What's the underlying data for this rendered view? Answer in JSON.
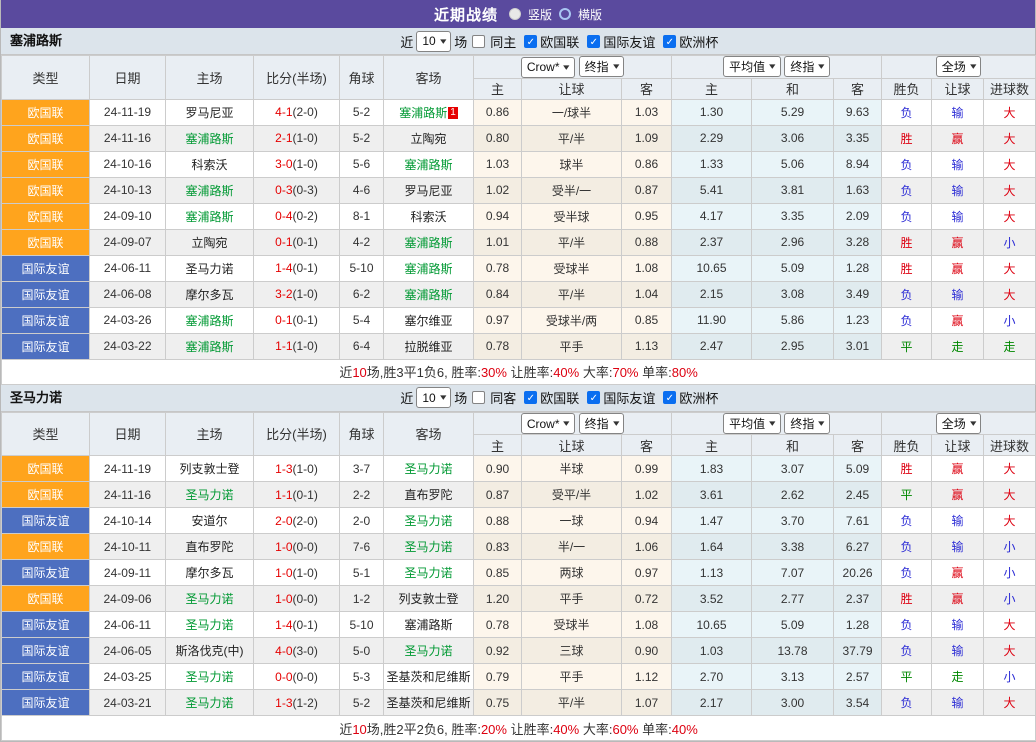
{
  "title_bar": {
    "title": "近期战绩",
    "radio_options": [
      {
        "label": "竖版",
        "selected": true
      },
      {
        "label": "横版",
        "selected": false
      }
    ]
  },
  "columns": {
    "type": "类型",
    "date": "日期",
    "home": "主场",
    "score": "比分(半场)",
    "corner": "角球",
    "away": "客场",
    "sub": [
      "主",
      "让球",
      "客",
      "主",
      "和",
      "客",
      "胜负",
      "让球",
      "进球数"
    ]
  },
  "league_colors": {
    "欧国联": "orange",
    "国际友谊": "blue"
  },
  "result_colors": {
    "胜": "red",
    "平": "green",
    "负": "blue",
    "赢": "red",
    "输": "blue",
    "走": "green",
    "大": "red",
    "小": "blue"
  },
  "colors": {
    "purple_bar": "#5a4a9e",
    "league_orange": "#ffa41d",
    "league_blue": "#4d6fc0",
    "team_highlight_green": "#009933",
    "score_red": "#e50000",
    "result_red": "#dd0010",
    "result_blue": "#2b2bd5",
    "result_green": "#008800"
  },
  "sections": [
    {
      "team": "塞浦路斯",
      "filters": {
        "near": "近",
        "count": "10",
        "games": "场",
        "same": "同主",
        "leagues": [
          "欧国联",
          "国际友谊",
          "欧洲杯"
        ]
      },
      "dropdowns": [
        "Crow*",
        "终指",
        "平均值",
        "终指",
        "全场"
      ],
      "rows": [
        {
          "lg": "欧国联",
          "dt": "24-11-19",
          "hm": "罗马尼亚",
          "hmG": false,
          "sc": "4-1",
          "hf": "(2-0)",
          "cn": "5-2",
          "aw": "塞浦路斯",
          "awG": true,
          "bd": "1",
          "od": [
            "0.86",
            "一/球半",
            "1.03"
          ],
          "av": [
            "1.30",
            "5.29",
            "9.63"
          ],
          "rs": [
            "负",
            "输",
            "大"
          ]
        },
        {
          "lg": "欧国联",
          "dt": "24-11-16",
          "hm": "塞浦路斯",
          "hmG": true,
          "sc": "2-1",
          "hf": "(1-0)",
          "cn": "5-2",
          "aw": "立陶宛",
          "awG": false,
          "od": [
            "0.80",
            "平/半",
            "1.09"
          ],
          "av": [
            "2.29",
            "3.06",
            "3.35"
          ],
          "rs": [
            "胜",
            "赢",
            "大"
          ]
        },
        {
          "lg": "欧国联",
          "dt": "24-10-16",
          "hm": "科索沃",
          "hmG": false,
          "sc": "3-0",
          "hf": "(1-0)",
          "cn": "5-6",
          "aw": "塞浦路斯",
          "awG": true,
          "od": [
            "1.03",
            "球半",
            "0.86"
          ],
          "av": [
            "1.33",
            "5.06",
            "8.94"
          ],
          "rs": [
            "负",
            "输",
            "大"
          ]
        },
        {
          "lg": "欧国联",
          "dt": "24-10-13",
          "hm": "塞浦路斯",
          "hmG": true,
          "sc": "0-3",
          "hf": "(0-3)",
          "cn": "4-6",
          "aw": "罗马尼亚",
          "awG": false,
          "od": [
            "1.02",
            "受半/一",
            "0.87"
          ],
          "av": [
            "5.41",
            "3.81",
            "1.63"
          ],
          "rs": [
            "负",
            "输",
            "大"
          ]
        },
        {
          "lg": "欧国联",
          "dt": "24-09-10",
          "hm": "塞浦路斯",
          "hmG": true,
          "sc": "0-4",
          "hf": "(0-2)",
          "cn": "8-1",
          "aw": "科索沃",
          "awG": false,
          "od": [
            "0.94",
            "受半球",
            "0.95"
          ],
          "av": [
            "4.17",
            "3.35",
            "2.09"
          ],
          "rs": [
            "负",
            "输",
            "大"
          ]
        },
        {
          "lg": "欧国联",
          "dt": "24-09-07",
          "hm": "立陶宛",
          "hmG": false,
          "sc": "0-1",
          "hf": "(0-1)",
          "cn": "4-2",
          "aw": "塞浦路斯",
          "awG": true,
          "od": [
            "1.01",
            "平/半",
            "0.88"
          ],
          "av": [
            "2.37",
            "2.96",
            "3.28"
          ],
          "rs": [
            "胜",
            "赢",
            "小"
          ]
        },
        {
          "lg": "国际友谊",
          "dt": "24-06-11",
          "hm": "圣马力诺",
          "hmG": false,
          "sc": "1-4",
          "hf": "(0-1)",
          "cn": "5-10",
          "aw": "塞浦路斯",
          "awG": true,
          "od": [
            "0.78",
            "受球半",
            "1.08"
          ],
          "av": [
            "10.65",
            "5.09",
            "1.28"
          ],
          "rs": [
            "胜",
            "赢",
            "大"
          ]
        },
        {
          "lg": "国际友谊",
          "dt": "24-06-08",
          "hm": "摩尔多瓦",
          "hmG": false,
          "sc": "3-2",
          "hf": "(1-0)",
          "cn": "6-2",
          "aw": "塞浦路斯",
          "awG": true,
          "od": [
            "0.84",
            "平/半",
            "1.04"
          ],
          "av": [
            "2.15",
            "3.08",
            "3.49"
          ],
          "rs": [
            "负",
            "输",
            "大"
          ]
        },
        {
          "lg": "国际友谊",
          "dt": "24-03-26",
          "hm": "塞浦路斯",
          "hmG": true,
          "sc": "0-1",
          "hf": "(0-1)",
          "cn": "5-4",
          "aw": "塞尔维亚",
          "awG": false,
          "od": [
            "0.97",
            "受球半/两",
            "0.85"
          ],
          "av": [
            "11.90",
            "5.86",
            "1.23"
          ],
          "rs": [
            "负",
            "赢",
            "小"
          ]
        },
        {
          "lg": "国际友谊",
          "dt": "24-03-22",
          "hm": "塞浦路斯",
          "hmG": true,
          "sc": "1-1",
          "hf": "(1-0)",
          "cn": "6-4",
          "aw": "拉脱维亚",
          "awG": false,
          "od": [
            "0.78",
            "平手",
            "1.13"
          ],
          "av": [
            "2.47",
            "2.95",
            "3.01"
          ],
          "rs": [
            "平",
            "走",
            "走"
          ]
        }
      ],
      "summary": [
        {
          "t": "近",
          "c": "dark"
        },
        {
          "t": "10",
          "c": "red"
        },
        {
          "t": "场,胜3平1负6, 胜率:",
          "c": "dark"
        },
        {
          "t": "30%",
          "c": "red"
        },
        {
          "t": " 让胜率:",
          "c": "dark"
        },
        {
          "t": "40%",
          "c": "red"
        },
        {
          "t": " 大率:",
          "c": "dark"
        },
        {
          "t": "70%",
          "c": "red"
        },
        {
          "t": " 单率:",
          "c": "dark"
        },
        {
          "t": "80%",
          "c": "red"
        }
      ]
    },
    {
      "team": "圣马力诺",
      "filters": {
        "near": "近",
        "count": "10",
        "games": "场",
        "same": "同客",
        "leagues": [
          "欧国联",
          "国际友谊",
          "欧洲杯"
        ]
      },
      "dropdowns": [
        "Crow*",
        "终指",
        "平均值",
        "终指",
        "全场"
      ],
      "rows": [
        {
          "lg": "欧国联",
          "dt": "24-11-19",
          "hm": "列支敦士登",
          "hmG": false,
          "sc": "1-3",
          "hf": "(1-0)",
          "cn": "3-7",
          "aw": "圣马力诺",
          "awG": true,
          "od": [
            "0.90",
            "半球",
            "0.99"
          ],
          "av": [
            "1.83",
            "3.07",
            "5.09"
          ],
          "rs": [
            "胜",
            "赢",
            "大"
          ]
        },
        {
          "lg": "欧国联",
          "dt": "24-11-16",
          "hm": "圣马力诺",
          "hmG": true,
          "sc": "1-1",
          "hf": "(0-1)",
          "cn": "2-2",
          "aw": "直布罗陀",
          "awG": false,
          "od": [
            "0.87",
            "受平/半",
            "1.02"
          ],
          "av": [
            "3.61",
            "2.62",
            "2.45"
          ],
          "rs": [
            "平",
            "赢",
            "大"
          ]
        },
        {
          "lg": "国际友谊",
          "dt": "24-10-14",
          "hm": "安道尔",
          "hmG": false,
          "sc": "2-0",
          "hf": "(2-0)",
          "cn": "2-0",
          "aw": "圣马力诺",
          "awG": true,
          "od": [
            "0.88",
            "一球",
            "0.94"
          ],
          "av": [
            "1.47",
            "3.70",
            "7.61"
          ],
          "rs": [
            "负",
            "输",
            "大"
          ]
        },
        {
          "lg": "欧国联",
          "dt": "24-10-11",
          "hm": "直布罗陀",
          "hmG": false,
          "sc": "1-0",
          "hf": "(0-0)",
          "cn": "7-6",
          "aw": "圣马力诺",
          "awG": true,
          "od": [
            "0.83",
            "半/一",
            "1.06"
          ],
          "av": [
            "1.64",
            "3.38",
            "6.27"
          ],
          "rs": [
            "负",
            "输",
            "小"
          ]
        },
        {
          "lg": "国际友谊",
          "dt": "24-09-11",
          "hm": "摩尔多瓦",
          "hmG": false,
          "sc": "1-0",
          "hf": "(1-0)",
          "cn": "5-1",
          "aw": "圣马力诺",
          "awG": true,
          "od": [
            "0.85",
            "两球",
            "0.97"
          ],
          "av": [
            "1.13",
            "7.07",
            "20.26"
          ],
          "rs": [
            "负",
            "赢",
            "小"
          ]
        },
        {
          "lg": "欧国联",
          "dt": "24-09-06",
          "hm": "圣马力诺",
          "hmG": true,
          "sc": "1-0",
          "hf": "(0-0)",
          "cn": "1-2",
          "aw": "列支敦士登",
          "awG": false,
          "od": [
            "1.20",
            "平手",
            "0.72"
          ],
          "av": [
            "3.52",
            "2.77",
            "2.37"
          ],
          "rs": [
            "胜",
            "赢",
            "小"
          ]
        },
        {
          "lg": "国际友谊",
          "dt": "24-06-11",
          "hm": "圣马力诺",
          "hmG": true,
          "sc": "1-4",
          "hf": "(0-1)",
          "cn": "5-10",
          "aw": "塞浦路斯",
          "awG": false,
          "od": [
            "0.78",
            "受球半",
            "1.08"
          ],
          "av": [
            "10.65",
            "5.09",
            "1.28"
          ],
          "rs": [
            "负",
            "输",
            "大"
          ]
        },
        {
          "lg": "国际友谊",
          "dt": "24-06-05",
          "hm": "斯洛伐克(中)",
          "hmG": false,
          "sc": "4-0",
          "hf": "(3-0)",
          "cn": "5-0",
          "aw": "圣马力诺",
          "awG": true,
          "od": [
            "0.92",
            "三球",
            "0.90"
          ],
          "av": [
            "1.03",
            "13.78",
            "37.79"
          ],
          "rs": [
            "负",
            "输",
            "大"
          ]
        },
        {
          "lg": "国际友谊",
          "dt": "24-03-25",
          "hm": "圣马力诺",
          "hmG": true,
          "sc": "0-0",
          "hf": "(0-0)",
          "cn": "5-3",
          "aw": "圣基茨和尼维斯",
          "awG": false,
          "od": [
            "0.79",
            "平手",
            "1.12"
          ],
          "av": [
            "2.70",
            "3.13",
            "2.57"
          ],
          "rs": [
            "平",
            "走",
            "小"
          ]
        },
        {
          "lg": "国际友谊",
          "dt": "24-03-21",
          "hm": "圣马力诺",
          "hmG": true,
          "sc": "1-3",
          "hf": "(1-2)",
          "cn": "5-2",
          "aw": "圣基茨和尼维斯",
          "awG": false,
          "od": [
            "0.75",
            "平/半",
            "1.07"
          ],
          "av": [
            "2.17",
            "3.00",
            "3.54"
          ],
          "rs": [
            "负",
            "输",
            "大"
          ]
        }
      ],
      "summary": [
        {
          "t": "近",
          "c": "dark"
        },
        {
          "t": "10",
          "c": "red"
        },
        {
          "t": "场,胜2平2负6, 胜率:",
          "c": "dark"
        },
        {
          "t": "20%",
          "c": "red"
        },
        {
          "t": " 让胜率:",
          "c": "dark"
        },
        {
          "t": "40%",
          "c": "red"
        },
        {
          "t": " 大率:",
          "c": "dark"
        },
        {
          "t": "60%",
          "c": "red"
        },
        {
          "t": " 单率:",
          "c": "dark"
        },
        {
          "t": "40%",
          "c": "red"
        }
      ]
    }
  ]
}
